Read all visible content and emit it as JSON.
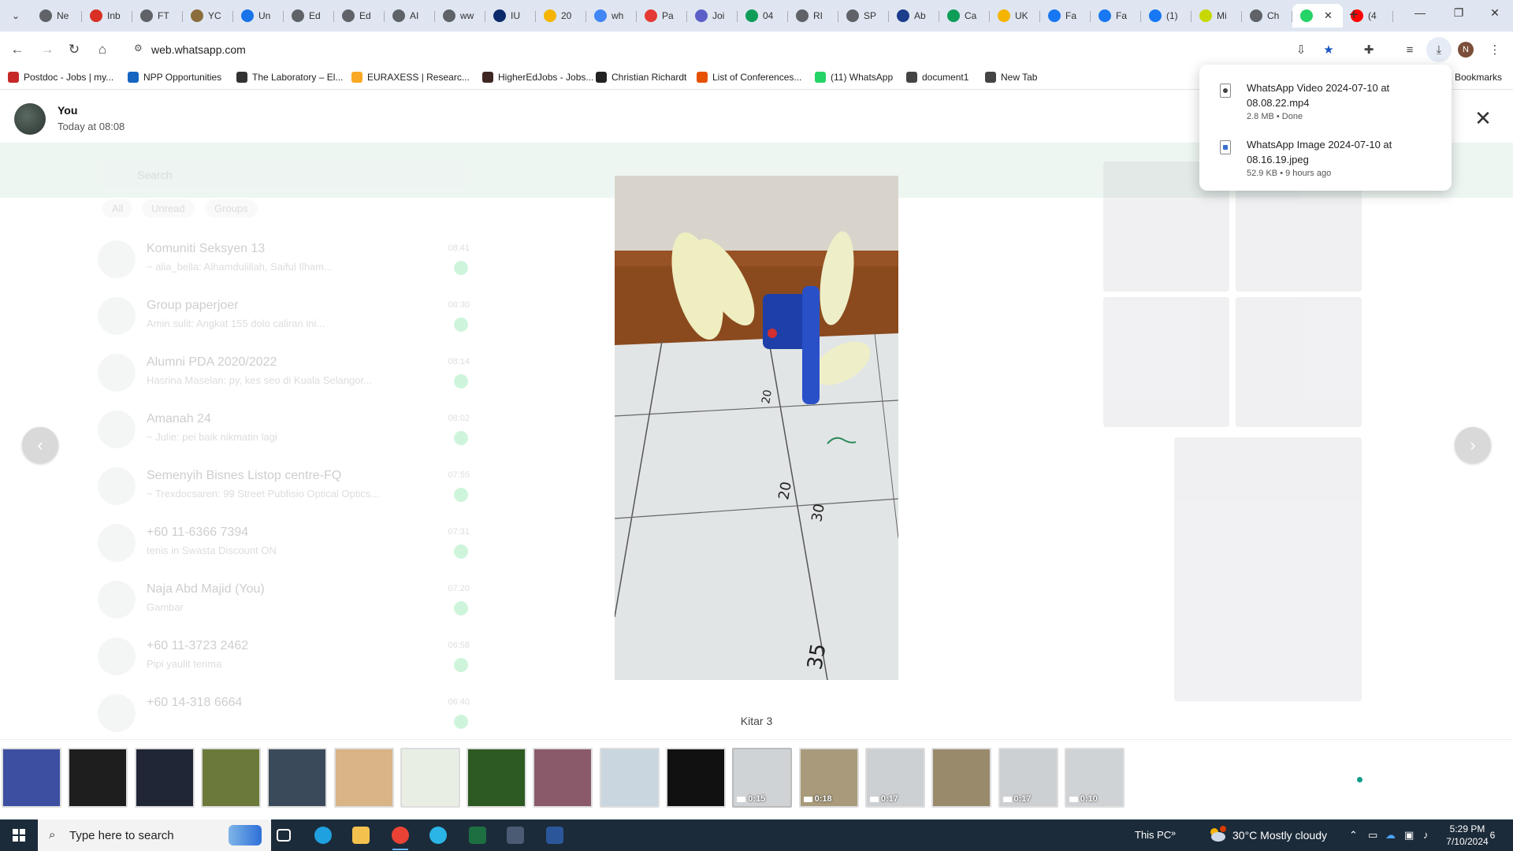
{
  "tabs": [
    {
      "label": "Ne",
      "color": "#5f6368"
    },
    {
      "label": "Inb",
      "color": "#d93025"
    },
    {
      "label": "FT",
      "color": "#5f6368"
    },
    {
      "label": "YC",
      "color": "#8a6d3b"
    },
    {
      "label": "Un",
      "color": "#1a73e8"
    },
    {
      "label": "Ed",
      "color": "#5f6368"
    },
    {
      "label": "Ed",
      "color": "#5f6368"
    },
    {
      "label": "AI",
      "color": "#5f6368"
    },
    {
      "label": "ww",
      "color": "#5f6368"
    },
    {
      "label": "IU",
      "color": "#0b2a6b"
    },
    {
      "label": "20",
      "color": "#f4b400"
    },
    {
      "label": "wh",
      "color": "#4285f4"
    },
    {
      "label": "Pa",
      "color": "#e53935"
    },
    {
      "label": "Joi",
      "color": "#5b5fc7"
    },
    {
      "label": "04",
      "color": "#0f9d58"
    },
    {
      "label": "RI",
      "color": "#5f6368"
    },
    {
      "label": "SP",
      "color": "#5f6368"
    },
    {
      "label": "Ab",
      "color": "#1a3c8a"
    },
    {
      "label": "Ca",
      "color": "#0f9d58"
    },
    {
      "label": "UK",
      "color": "#f4b400"
    },
    {
      "label": "Fa",
      "color": "#1877f2"
    },
    {
      "label": "Fa",
      "color": "#1877f2"
    },
    {
      "label": "(1)",
      "color": "#1877f2"
    },
    {
      "label": "Mi",
      "color": "#c7d800"
    },
    {
      "label": "Ch",
      "color": "#5f6368"
    },
    {
      "label": "",
      "color": "#25d366",
      "active": true
    },
    {
      "label": "(4",
      "color": "#ff0000"
    }
  ],
  "tab_close_glyph": "✕",
  "url": "web.whatsapp.com",
  "profile_initial": "N",
  "bookmarks": [
    {
      "label": "Postdoc - Jobs | my...",
      "color": "#c62828"
    },
    {
      "label": "NPP Opportunities",
      "color": "#1565c0"
    },
    {
      "label": "The Laboratory – El...",
      "color": "#333333"
    },
    {
      "label": "EURAXESS | Researc...",
      "color": "#f9a825"
    },
    {
      "label": "HigherEdJobs - Jobs...",
      "color": "#3e2723"
    },
    {
      "label": "Christian Richardt",
      "color": "#222222"
    },
    {
      "label": "List of Conferences...",
      "color": "#e65100"
    },
    {
      "label": "(11) WhatsApp",
      "color": "#25d366"
    },
    {
      "label": "document1",
      "color": "#444444"
    },
    {
      "label": "New Tab",
      "color": "#444444"
    }
  ],
  "bookmarks_all_label": "Bookmarks",
  "downloads": [
    {
      "name": "WhatsApp Video 2024-07-10 at 08.08.22.mp4",
      "meta": "2.8 MB • Done",
      "kind": "video"
    },
    {
      "name": "WhatsApp Image 2024-07-10 at 08.16.19.jpeg",
      "meta": "52.9 KB • 9 hours ago",
      "kind": "image"
    }
  ],
  "viewer": {
    "sender": "You",
    "timestamp": "Today at 08:08",
    "caption": "Kitar 3",
    "close_glyph": "✕",
    "prev_glyph": "‹",
    "next_glyph": "›"
  },
  "background_chat": {
    "search_placeholder": "Search",
    "filters": [
      "All",
      "Unread",
      "Groups"
    ],
    "chats": [
      {
        "name": "Komuniti Seksyen 13",
        "preview": "~ alia_bella: Alhamdulillah, Saiful Ilham...",
        "time": "08:41"
      },
      {
        "name": "Group paperjoer",
        "preview": "Amin sulit: Angkat 155 dolo caliran ini...",
        "time": "08:30"
      },
      {
        "name": "Alumni PDA 2020/2022",
        "preview": "Hasrina Maselan: py, kes seo di Kuala Selangor...",
        "time": "08:14"
      },
      {
        "name": "Amanah 24",
        "preview": "~ Julie: pei baik nikmatin lagi",
        "time": "08:02"
      },
      {
        "name": "Semenyih Bisnes   Listop centre-FQ",
        "preview": "~ Trexdocsaren: 99 Street Pubfisio Optical Optics...",
        "time": "07:55"
      },
      {
        "name": "+60 11-6366 7394",
        "preview": "tenis in Swasta Discount ON",
        "time": "07:31"
      },
      {
        "name": "Naja Abd Majid (You)",
        "preview": "Gambar",
        "time": "07:20"
      },
      {
        "name": "+60 11-3723 2462",
        "preview": "Pipi yaulit terima",
        "time": "06:58"
      },
      {
        "name": "+60 14-318 6664",
        "preview": "",
        "time": "06:40"
      }
    ]
  },
  "thumbnails": [
    {
      "color": "#3d4fa0",
      "duration": ""
    },
    {
      "color": "#1e1e1e",
      "duration": ""
    },
    {
      "color": "#202636",
      "duration": ""
    },
    {
      "color": "#6b7a3a",
      "duration": ""
    },
    {
      "color": "#3a4a5a",
      "duration": ""
    },
    {
      "color": "#d9b486",
      "duration": ""
    },
    {
      "color": "#e8eee4",
      "duration": ""
    },
    {
      "color": "#2d5a22",
      "duration": ""
    },
    {
      "color": "#8a5a6a",
      "duration": ""
    },
    {
      "color": "#c9d6e0",
      "duration": ""
    },
    {
      "color": "#111111",
      "duration": ""
    },
    {
      "color": "#cfd3d6",
      "duration": "0:15",
      "selected": true
    },
    {
      "color": "#a89a7a",
      "duration": "0:18"
    },
    {
      "color": "#cdd0d2",
      "duration": "0:17"
    },
    {
      "color": "#9a8a6c",
      "duration": ""
    },
    {
      "color": "#cdd0d2",
      "duration": "0:17"
    },
    {
      "color": "#d0d3d5",
      "duration": "0:10"
    }
  ],
  "taskbar": {
    "search_placeholder": "Type here to search",
    "this_pc": "This PC",
    "weather": "30°C  Mostly cloudy",
    "time": "5:29 PM",
    "date": "7/10/2024",
    "notification_count": "6",
    "apps": [
      {
        "name": "task-view",
        "color": "#ffffff"
      },
      {
        "name": "edge",
        "color": "#1fa1e0"
      },
      {
        "name": "file-explorer",
        "color": "#f2c14e"
      },
      {
        "name": "chrome",
        "color": "#ea4335",
        "open": true
      },
      {
        "name": "webex",
        "color": "#2bb5e6"
      },
      {
        "name": "excel",
        "color": "#1d6f42"
      },
      {
        "name": "calculator",
        "color": "#4a5b73"
      },
      {
        "name": "word",
        "color": "#2b579a"
      }
    ]
  }
}
